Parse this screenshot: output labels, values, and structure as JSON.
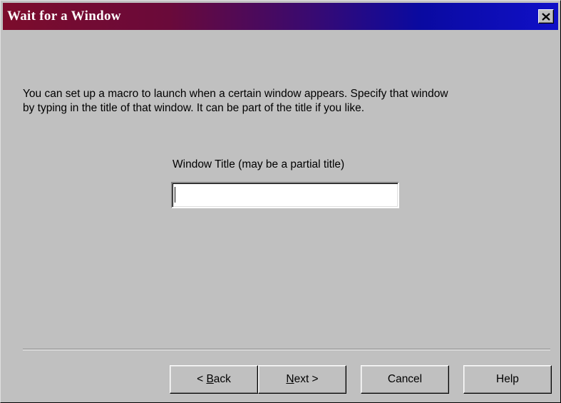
{
  "window": {
    "title": "Wait for a Window",
    "close_icon": "close-icon"
  },
  "description": "You can set up a macro to launch when a certain window appears.  Specify that window\nby typing in the title of that window.  It can be part of the title if you like.",
  "field": {
    "label": "Window Title (may be a partial title)",
    "value": ""
  },
  "buttons": {
    "back": {
      "mnemonic": "B",
      "pre": "< ",
      "rest": "ack"
    },
    "next": {
      "mnemonic": "N",
      "rest": "ext >"
    },
    "cancel": "Cancel",
    "help": "Help"
  },
  "colors": {
    "face": "#c0c0c0",
    "titlebar_start": "#7c0c2c",
    "titlebar_end": "#1010c8"
  }
}
